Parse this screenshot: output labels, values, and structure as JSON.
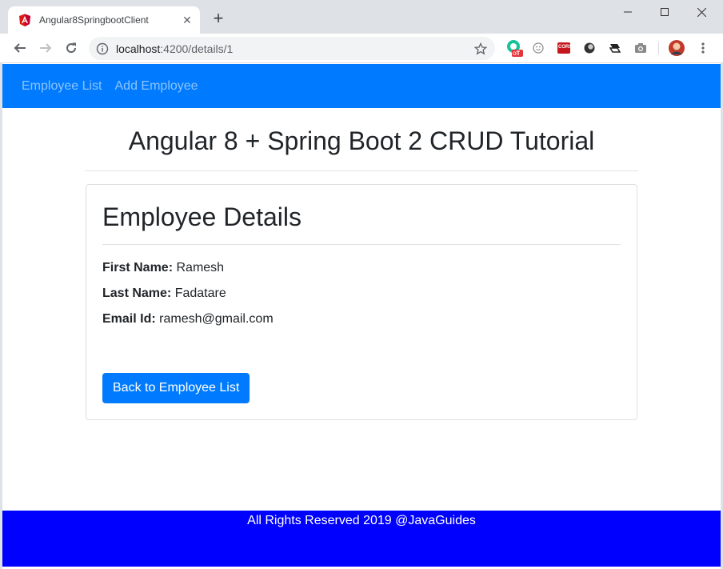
{
  "browser": {
    "tab_title": "Angular8SpringbootClient",
    "url_host": "localhost",
    "url_rest": ":4200/details/1",
    "ext_off_badge": "off",
    "ext_cors_badge": "CORS"
  },
  "navbar": {
    "links": [
      "Employee List",
      "Add Employee"
    ],
    "bg_color": "#007bff"
  },
  "header": {
    "title": "Angular 8 + Spring Boot 2 CRUD Tutorial"
  },
  "details": {
    "title": "Employee Details",
    "fields": [
      {
        "label": "First Name:",
        "value": "Ramesh"
      },
      {
        "label": "Last Name:",
        "value": "Fadatare"
      },
      {
        "label": "Email Id:",
        "value": "ramesh@gmail.com"
      }
    ],
    "back_button": "Back to Employee List"
  },
  "footer": {
    "text": "All Rights Reserved 2019 @JavaGuides",
    "bg_color": "#0000ff"
  },
  "icons": [
    "angular-favicon",
    "back-arrow-icon",
    "forward-arrow-icon",
    "reload-icon",
    "info-icon",
    "star-icon",
    "minimize-icon",
    "maximize-icon",
    "close-icon"
  ]
}
